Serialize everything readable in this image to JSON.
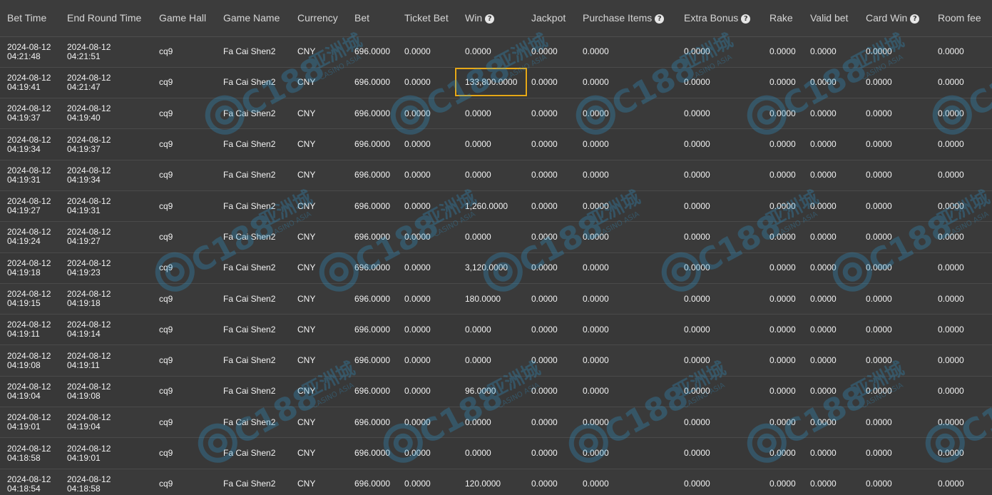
{
  "table": {
    "columns": [
      {
        "label": "Bet Time",
        "help": false
      },
      {
        "label": "End Round Time",
        "help": false
      },
      {
        "label": "Game Hall",
        "help": false
      },
      {
        "label": "Game Name",
        "help": false
      },
      {
        "label": "Currency",
        "help": false
      },
      {
        "label": "Bet",
        "help": false
      },
      {
        "label": "Ticket Bet",
        "help": false
      },
      {
        "label": "Win",
        "help": true
      },
      {
        "label": "Jackpot",
        "help": false
      },
      {
        "label": "Purchase Items",
        "help": true
      },
      {
        "label": "Extra Bonus",
        "help": true
      },
      {
        "label": "Rake",
        "help": false
      },
      {
        "label": "Valid bet",
        "help": false
      },
      {
        "label": "Card Win",
        "help": true
      },
      {
        "label": "Room fee",
        "help": false
      }
    ],
    "help_glyph": "?",
    "rows": [
      {
        "bet_date": "2024-08-12",
        "bet_time": "04:21:48",
        "end_date": "2024-08-12",
        "end_time": "04:21:51",
        "hall": "cq9",
        "game": "Fa Cai Shen2",
        "currency": "CNY",
        "bet": "696.0000",
        "ticket_bet": "0.0000",
        "win": "0.0000",
        "jackpot": "0.0000",
        "purchase": "0.0000",
        "extra_bonus": "0.0000",
        "rake": "0.0000",
        "valid_bet": "0.0000",
        "card_win": "0.0000",
        "room_fee": "0.0000"
      },
      {
        "bet_date": "2024-08-12",
        "bet_time": "04:19:41",
        "end_date": "2024-08-12",
        "end_time": "04:21:47",
        "hall": "cq9",
        "game": "Fa Cai Shen2",
        "currency": "CNY",
        "bet": "696.0000",
        "ticket_bet": "0.0000",
        "win": "133,800.0000",
        "jackpot": "0.0000",
        "purchase": "0.0000",
        "extra_bonus": "0.0000",
        "rake": "0.0000",
        "valid_bet": "0.0000",
        "card_win": "0.0000",
        "room_fee": "0.0000",
        "highlight": true
      },
      {
        "bet_date": "2024-08-12",
        "bet_time": "04:19:37",
        "end_date": "2024-08-12",
        "end_time": "04:19:40",
        "hall": "cq9",
        "game": "Fa Cai Shen2",
        "currency": "CNY",
        "bet": "696.0000",
        "ticket_bet": "0.0000",
        "win": "0.0000",
        "jackpot": "0.0000",
        "purchase": "0.0000",
        "extra_bonus": "0.0000",
        "rake": "0.0000",
        "valid_bet": "0.0000",
        "card_win": "0.0000",
        "room_fee": "0.0000"
      },
      {
        "bet_date": "2024-08-12",
        "bet_time": "04:19:34",
        "end_date": "2024-08-12",
        "end_time": "04:19:37",
        "hall": "cq9",
        "game": "Fa Cai Shen2",
        "currency": "CNY",
        "bet": "696.0000",
        "ticket_bet": "0.0000",
        "win": "0.0000",
        "jackpot": "0.0000",
        "purchase": "0.0000",
        "extra_bonus": "0.0000",
        "rake": "0.0000",
        "valid_bet": "0.0000",
        "card_win": "0.0000",
        "room_fee": "0.0000"
      },
      {
        "bet_date": "2024-08-12",
        "bet_time": "04:19:31",
        "end_date": "2024-08-12",
        "end_time": "04:19:34",
        "hall": "cq9",
        "game": "Fa Cai Shen2",
        "currency": "CNY",
        "bet": "696.0000",
        "ticket_bet": "0.0000",
        "win": "0.0000",
        "jackpot": "0.0000",
        "purchase": "0.0000",
        "extra_bonus": "0.0000",
        "rake": "0.0000",
        "valid_bet": "0.0000",
        "card_win": "0.0000",
        "room_fee": "0.0000"
      },
      {
        "bet_date": "2024-08-12",
        "bet_time": "04:19:27",
        "end_date": "2024-08-12",
        "end_time": "04:19:31",
        "hall": "cq9",
        "game": "Fa Cai Shen2",
        "currency": "CNY",
        "bet": "696.0000",
        "ticket_bet": "0.0000",
        "win": "1,260.0000",
        "jackpot": "0.0000",
        "purchase": "0.0000",
        "extra_bonus": "0.0000",
        "rake": "0.0000",
        "valid_bet": "0.0000",
        "card_win": "0.0000",
        "room_fee": "0.0000"
      },
      {
        "bet_date": "2024-08-12",
        "bet_time": "04:19:24",
        "end_date": "2024-08-12",
        "end_time": "04:19:27",
        "hall": "cq9",
        "game": "Fa Cai Shen2",
        "currency": "CNY",
        "bet": "696.0000",
        "ticket_bet": "0.0000",
        "win": "0.0000",
        "jackpot": "0.0000",
        "purchase": "0.0000",
        "extra_bonus": "0.0000",
        "rake": "0.0000",
        "valid_bet": "0.0000",
        "card_win": "0.0000",
        "room_fee": "0.0000"
      },
      {
        "bet_date": "2024-08-12",
        "bet_time": "04:19:18",
        "end_date": "2024-08-12",
        "end_time": "04:19:23",
        "hall": "cq9",
        "game": "Fa Cai Shen2",
        "currency": "CNY",
        "bet": "696.0000",
        "ticket_bet": "0.0000",
        "win": "3,120.0000",
        "jackpot": "0.0000",
        "purchase": "0.0000",
        "extra_bonus": "0.0000",
        "rake": "0.0000",
        "valid_bet": "0.0000",
        "card_win": "0.0000",
        "room_fee": "0.0000"
      },
      {
        "bet_date": "2024-08-12",
        "bet_time": "04:19:15",
        "end_date": "2024-08-12",
        "end_time": "04:19:18",
        "hall": "cq9",
        "game": "Fa Cai Shen2",
        "currency": "CNY",
        "bet": "696.0000",
        "ticket_bet": "0.0000",
        "win": "180.0000",
        "jackpot": "0.0000",
        "purchase": "0.0000",
        "extra_bonus": "0.0000",
        "rake": "0.0000",
        "valid_bet": "0.0000",
        "card_win": "0.0000",
        "room_fee": "0.0000"
      },
      {
        "bet_date": "2024-08-12",
        "bet_time": "04:19:11",
        "end_date": "2024-08-12",
        "end_time": "04:19:14",
        "hall": "cq9",
        "game": "Fa Cai Shen2",
        "currency": "CNY",
        "bet": "696.0000",
        "ticket_bet": "0.0000",
        "win": "0.0000",
        "jackpot": "0.0000",
        "purchase": "0.0000",
        "extra_bonus": "0.0000",
        "rake": "0.0000",
        "valid_bet": "0.0000",
        "card_win": "0.0000",
        "room_fee": "0.0000"
      },
      {
        "bet_date": "2024-08-12",
        "bet_time": "04:19:08",
        "end_date": "2024-08-12",
        "end_time": "04:19:11",
        "hall": "cq9",
        "game": "Fa Cai Shen2",
        "currency": "CNY",
        "bet": "696.0000",
        "ticket_bet": "0.0000",
        "win": "0.0000",
        "jackpot": "0.0000",
        "purchase": "0.0000",
        "extra_bonus": "0.0000",
        "rake": "0.0000",
        "valid_bet": "0.0000",
        "card_win": "0.0000",
        "room_fee": "0.0000"
      },
      {
        "bet_date": "2024-08-12",
        "bet_time": "04:19:04",
        "end_date": "2024-08-12",
        "end_time": "04:19:08",
        "hall": "cq9",
        "game": "Fa Cai Shen2",
        "currency": "CNY",
        "bet": "696.0000",
        "ticket_bet": "0.0000",
        "win": "96.0000",
        "jackpot": "0.0000",
        "purchase": "0.0000",
        "extra_bonus": "0.0000",
        "rake": "0.0000",
        "valid_bet": "0.0000",
        "card_win": "0.0000",
        "room_fee": "0.0000"
      },
      {
        "bet_date": "2024-08-12",
        "bet_time": "04:19:01",
        "end_date": "2024-08-12",
        "end_time": "04:19:04",
        "hall": "cq9",
        "game": "Fa Cai Shen2",
        "currency": "CNY",
        "bet": "696.0000",
        "ticket_bet": "0.0000",
        "win": "0.0000",
        "jackpot": "0.0000",
        "purchase": "0.0000",
        "extra_bonus": "0.0000",
        "rake": "0.0000",
        "valid_bet": "0.0000",
        "card_win": "0.0000",
        "room_fee": "0.0000"
      },
      {
        "bet_date": "2024-08-12",
        "bet_time": "04:18:58",
        "end_date": "2024-08-12",
        "end_time": "04:19:01",
        "hall": "cq9",
        "game": "Fa Cai Shen2",
        "currency": "CNY",
        "bet": "696.0000",
        "ticket_bet": "0.0000",
        "win": "0.0000",
        "jackpot": "0.0000",
        "purchase": "0.0000",
        "extra_bonus": "0.0000",
        "rake": "0.0000",
        "valid_bet": "0.0000",
        "card_win": "0.0000",
        "room_fee": "0.0000"
      },
      {
        "bet_date": "2024-08-12",
        "bet_time": "04:18:54",
        "end_date": "2024-08-12",
        "end_time": "04:18:58",
        "hall": "cq9",
        "game": "Fa Cai Shen2",
        "currency": "CNY",
        "bet": "696.0000",
        "ticket_bet": "0.0000",
        "win": "120.0000",
        "jackpot": "0.0000",
        "purchase": "0.0000",
        "extra_bonus": "0.0000",
        "rake": "0.0000",
        "valid_bet": "0.0000",
        "card_win": "0.0000",
        "room_fee": "0.0000"
      }
    ]
  },
  "watermark": {
    "brand": "C188",
    "chinese": "亚洲城",
    "sub": "CASINO ASIA",
    "color": "#2f9fd8"
  },
  "colors": {
    "background": "#3a3a3a",
    "text": "#f2f2f2",
    "header_text": "#d6d6d6",
    "highlight_border": "#e6a817"
  }
}
